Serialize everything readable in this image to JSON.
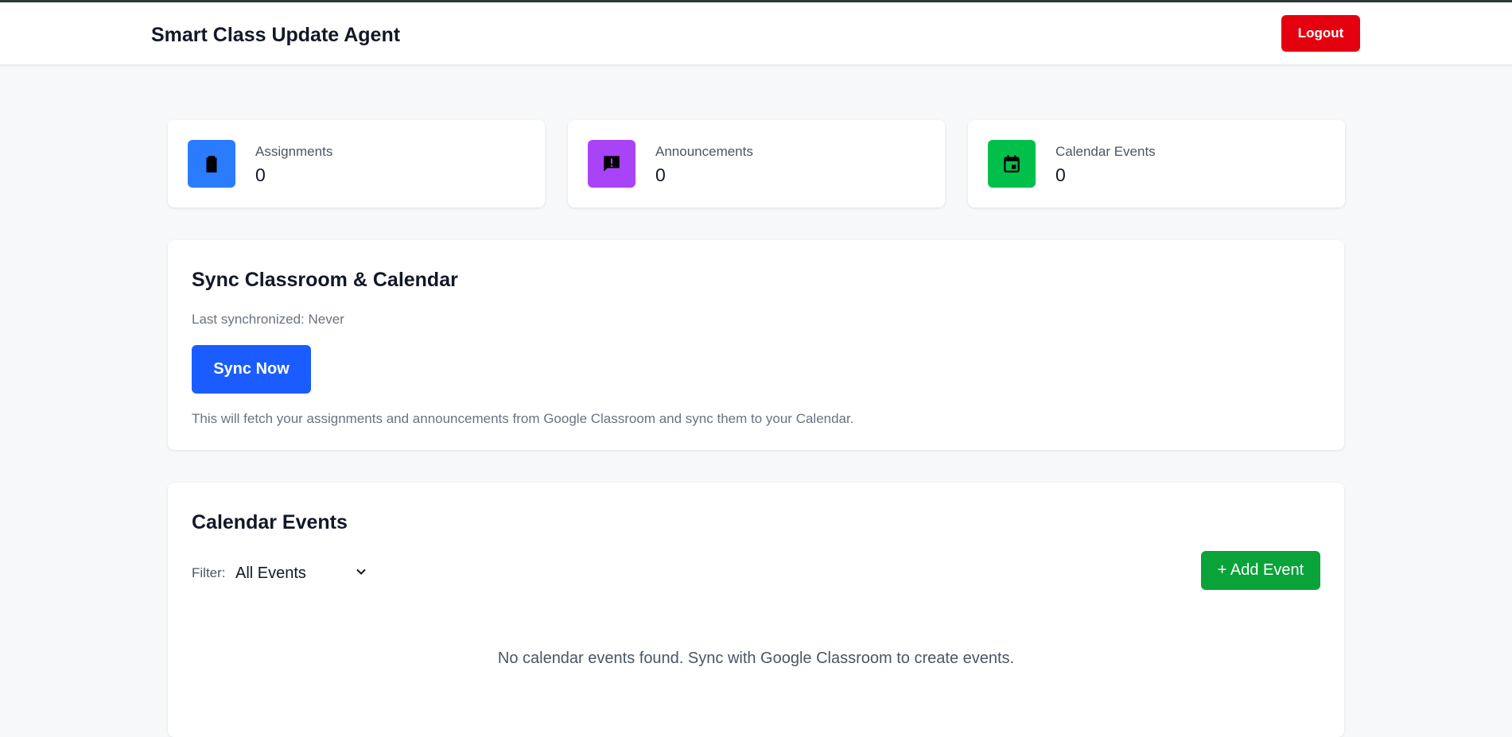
{
  "header": {
    "title": "Smart Class Update Agent",
    "logout_label": "Logout"
  },
  "stats": [
    {
      "label": "Assignments",
      "value": "0",
      "icon": "clipboard-icon",
      "color": "#2b7bff"
    },
    {
      "label": "Announcements",
      "value": "0",
      "icon": "announcement-icon",
      "color": "#a843f7"
    },
    {
      "label": "Calendar Events",
      "value": "0",
      "icon": "calendar-icon",
      "color": "#00c04b"
    }
  ],
  "sync": {
    "title": "Sync Classroom & Calendar",
    "last_synced": "Last synchronized: Never",
    "button_label": "Sync Now",
    "description": "This will fetch your assignments and announcements from Google Classroom and sync them to your Calendar."
  },
  "events": {
    "title": "Calendar Events",
    "filter_label": "Filter:",
    "filter_value": "All Events",
    "add_label": "+ Add Event",
    "empty_message": "No calendar events found. Sync with Google Classroom to create events."
  },
  "colors": {
    "logout": "#e5000f",
    "sync_button": "#1a5cff",
    "add_button": "#0aa33a",
    "background": "#f7f8fa"
  }
}
